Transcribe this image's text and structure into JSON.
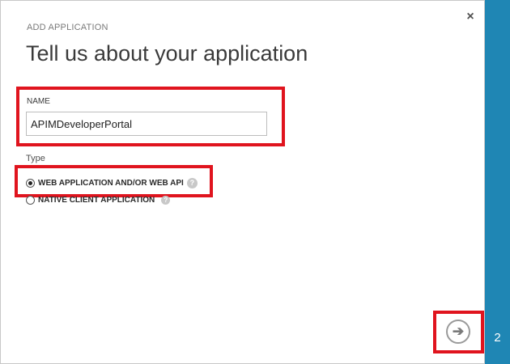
{
  "dialog": {
    "subtitle": "ADD APPLICATION",
    "title": "Tell us about your application",
    "close_glyph": "×",
    "close_icon": "close-icon"
  },
  "form": {
    "name_label": "NAME",
    "name_value": "APIMDeveloperPortal",
    "type_label": "Type",
    "options": [
      {
        "label": "WEB APPLICATION AND/OR WEB API",
        "checked": true
      },
      {
        "label": "NATIVE CLIENT APPLICATION",
        "checked": false
      }
    ],
    "help_glyph": "?",
    "help_icon": "help-icon"
  },
  "wizard": {
    "step": "2",
    "next_glyph": "➔",
    "next_icon": "arrow-right-icon"
  },
  "colors": {
    "accent": "#1f86b4",
    "highlight": "#e0141e"
  }
}
